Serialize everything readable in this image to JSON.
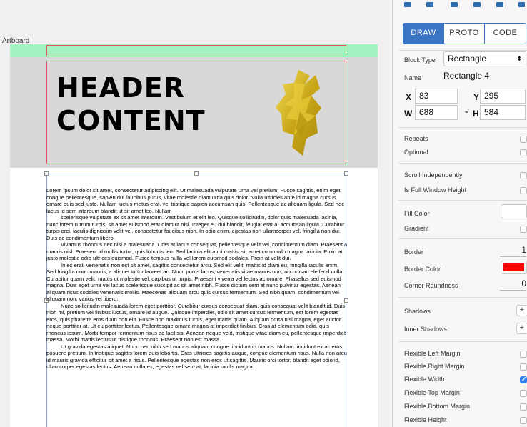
{
  "canvas": {
    "artboard_label": "Artboard",
    "header_lines": [
      "HEADER",
      "CONTENT"
    ],
    "body_paragraphs": [
      "Lorem ipsum dolor sit amet, consectetur adipiscing elit. Ut malesuada vulputate urna vel pretium. Fusce sagittis, enim eget congue pellentesque, sapien dui faucibus purus, vitae molestie diam urna quis dolor. Nulla ultricies ante id magna cursus ornare quis sed justo. Nullam luctus metus erat, vel tristique sapien accumsan quis. Pellentesque ac aliquam ligula. Sed nec lacus id sem interdum blandit ut sit amet leo. Nullam",
      "scelerisque vulputate ex sit amet interdum. Vestibulum et elit leo. Quisque sollicitudin, dolor quis malesuada lacinia, nunc lorem rutrum turpis, sit amet euismod erat diam ut nisl. Integer eu dui blandit, feugiat erat a, accumsan ligula. Curabitur turpis orci, iaculis dignissim velit vel, consectetur faucibus nibh. In odio enim, egestas non ullamcorper vel, fringilla non dui. Duis ac condimentum libero.",
      "Vivamus rhoncus nec nisi a malesuada. Cras at lacus consequat, pellentesque velit vel, condimentum diam. Praesent a mauris nisl. Praesent id mollis tortor, quis lobortis leo. Sed lacinia elit a mi mattis, sit amet commodo magna lacinia. Proin at justo molestie odio ultrices euismod. Fusce tempus nulla vel lorem euismod sodales. Proin at velit dui.",
      "In ex erat, venenatis non est sit amet, sagittis consectetur arcu. Sed elit velit, mattis id diam eu, fringilla iaculis enim. Sed fringilla nunc mauris, a aliquet tortor laoreet ac. Nunc purus lacus, venenatis vitae mauris non, accumsan eleifend nulla. Curabitur quam velit, mattis ut molestie vel, dapibus ut turpis. Praesent viverra vel lectus ac ornare. Phasellus sed euismod magna. Duis eget urna vel lacus scelerisque suscipit ac sit amet nibh. Fusce dictum sem at nunc pulvinar egestas. Aenean aliquam risus sodales venenatis mollis. Maecenas aliquam arcu quis cursus fermentum. Sed nibh quam, condimentum vel aliquam non, varius vel libero.",
      "Nunc sollicitudin malesuada lorem eget porttitor. Curabitur cursus consequat diam, quis consequat velit blandit id. Duis nibh mi, pretium vel finibus luctus, ornare id augue. Quisque imperdiet, odio sit amet cursus fermentum, est lorem egestas eros, quis pharetra eros diam non elit. Fusce non maximus turpis, eget mattis quam. Aliquam porta nisl magna, eget auctor neque porttitor at. Ut eu porttitor lectus. Pellentesque ornare magna at imperdiet finibus. Cras at elementum odio, quis rhoncus ipsum. Morbi tempor fermentum risus ac facilisis. Aenean neque velit, tristique vitae diam eu, pellentesque imperdiet massa. Morbi mattis lectus ut tristique rhoncus. Praesent non est massa.",
      "Ut gravida egestas aliquet. Nunc nec nibh sed mauris aliquam congue tincidunt id mauris. Nullam tincidunt ex ac eros posuere pretium. In tristique sagittis lorem quis lobortis. Cras ultricies sagittis augue, congue elementum risus. Nulla non arcu id mauris gravida efficitur sit amet a risus. Pellentesque egestas non eros ut sagittis. Mauris orci tortor, blandit eget odio id, ullamcorper egestas lectus. Aenean nulla ex, egestas vel sem at, lacinia mollis magna."
    ]
  },
  "panel": {
    "tabs": [
      {
        "label": "DRAW",
        "active": true
      },
      {
        "label": "PROTO",
        "active": false
      },
      {
        "label": "CODE",
        "active": false
      }
    ],
    "block_type_label": "Block Type",
    "block_type_value": "Rectangle",
    "name_label": "Name",
    "name_value": "Rectangle 4",
    "x_label": "X",
    "x_value": "83",
    "y_label": "Y",
    "y_value": "295",
    "w_label": "W",
    "w_value": "688",
    "h_label": "H",
    "h_value": "584",
    "repeats": "Repeats",
    "optional": "Optional",
    "scroll_independently": "Scroll Independently",
    "full_window_height": "Is Full Window Height",
    "fill_color": "Fill Color",
    "gradient": "Gradient",
    "border_label": "Border",
    "border_value": "1",
    "border_color_label": "Border Color",
    "border_color": "#ff0000",
    "corner_roundness_label": "Corner Roundness",
    "corner_roundness_value": "0",
    "shadows": "Shadows",
    "inner_shadows": "Inner Shadows",
    "flexible_left_margin": "Flexible Left Margin",
    "flexible_right_margin": "Flexible Right Margin",
    "flexible_width": "Flexible Width",
    "flexible_top_margin": "Flexible Top Margin",
    "flexible_bottom_margin": "Flexible Bottom Margin",
    "flexible_height": "Flexible Height",
    "plus_symbol": "+"
  }
}
